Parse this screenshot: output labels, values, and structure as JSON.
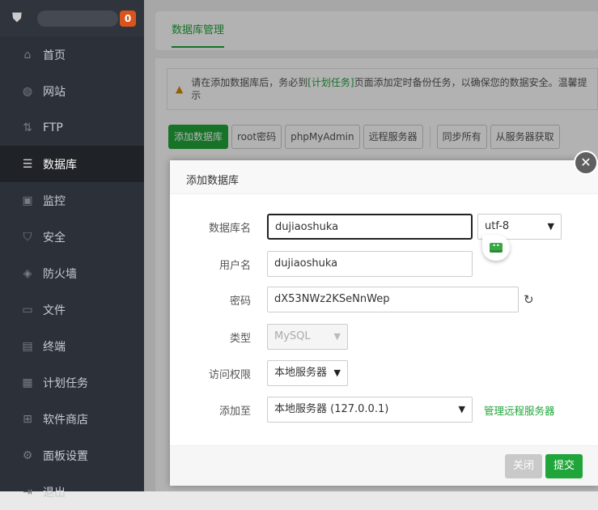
{
  "sidebar": {
    "badge": "0",
    "items": [
      {
        "label": "首页",
        "icon": "home-icon"
      },
      {
        "label": "网站",
        "icon": "globe-icon"
      },
      {
        "label": "FTP",
        "icon": "ftp-icon"
      },
      {
        "label": "数据库",
        "icon": "database-icon"
      },
      {
        "label": "监控",
        "icon": "monitor-icon"
      },
      {
        "label": "安全",
        "icon": "shield-icon"
      },
      {
        "label": "防火墙",
        "icon": "firewall-icon"
      },
      {
        "label": "文件",
        "icon": "folder-icon"
      },
      {
        "label": "终端",
        "icon": "terminal-icon"
      },
      {
        "label": "计划任务",
        "icon": "calendar-icon"
      },
      {
        "label": "软件商店",
        "icon": "apps-icon"
      },
      {
        "label": "面板设置",
        "icon": "gear-icon"
      },
      {
        "label": "退出",
        "icon": "logout-icon"
      }
    ]
  },
  "main": {
    "tab": "数据库管理",
    "warning": {
      "pre": "请在添加数据库后，务必到",
      "link": "[计划任务]",
      "post": "页面添加定时备份任务，以确保您的数据安全。温馨提示"
    },
    "buttons": [
      "添加数据库",
      "root密码",
      "phpMyAdmin",
      "远程服务器"
    ],
    "buttons2": [
      "同步所有",
      "从服务器获取"
    ]
  },
  "modal": {
    "title": "添加数据库",
    "fields": {
      "dbname_label": "数据库名",
      "dbname": "dujiaoshuka",
      "charset": "utf-8",
      "user_label": "用户名",
      "user": "dujiaoshuka",
      "pass_label": "密码",
      "pass": "dX53NWz2KSeNnWep",
      "type_label": "类型",
      "type": "MySQL",
      "access_label": "访问权限",
      "access": "本地服务器",
      "addto_label": "添加至",
      "addto": "本地服务器 (127.0.0.1)",
      "manage_link": "管理远程服务器"
    },
    "close_btn": "关闭",
    "submit_btn": "提交"
  }
}
